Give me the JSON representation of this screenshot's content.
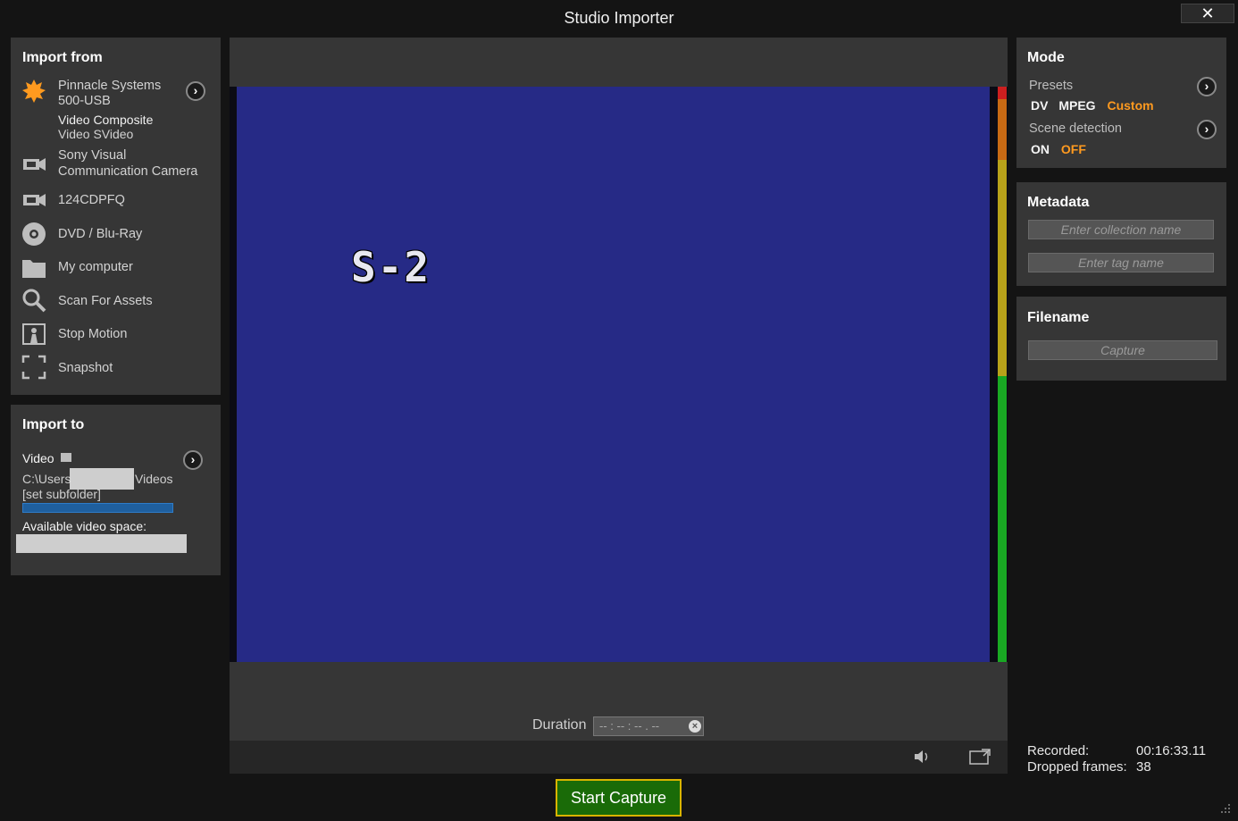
{
  "window": {
    "title": "Studio Importer",
    "close_glyph": "✕"
  },
  "import_from": {
    "title": "Import from",
    "sources": [
      {
        "icon": "gear-orange-icon",
        "line1": "Pinnacle Systems",
        "line2": "500-USB",
        "sub_label": "Video Composite",
        "sub_selected": "Video SVideo",
        "selected": true
      },
      {
        "icon": "camcorder-icon",
        "line1": "Sony Visual",
        "line2": "Communication Camera"
      },
      {
        "icon": "camcorder-icon",
        "line1": "124CDPFQ"
      },
      {
        "icon": "disc-icon",
        "line1": "DVD / Blu-Ray"
      },
      {
        "icon": "folder-icon",
        "line1": "My computer"
      },
      {
        "icon": "search-icon",
        "line1": "Scan For Assets"
      },
      {
        "icon": "stop-motion-icon",
        "line1": "Stop Motion"
      },
      {
        "icon": "snapshot-icon",
        "line1": "Snapshot"
      }
    ]
  },
  "import_to": {
    "title": "Import to",
    "type_label": "Video",
    "path_prefix": "C:\\Users",
    "path_suffix": "Videos",
    "subfolder": "[set subfolder]",
    "space_label": "Available video space:",
    "space_progress": 1.0
  },
  "preview": {
    "video_text": "S-2",
    "duration_label": "Duration",
    "duration_value": "-- : -- : -- . --",
    "level_colors": [
      "#cc1f1f",
      "#c86a14",
      "#b8a21a",
      "#19a823"
    ]
  },
  "mode": {
    "title": "Mode",
    "presets_label": "Presets",
    "presets_options": [
      "DV",
      "MPEG",
      "Custom"
    ],
    "presets_selected": "Custom",
    "scene_label": "Scene detection",
    "scene_options": [
      "ON",
      "OFF"
    ],
    "scene_selected": "OFF"
  },
  "metadata": {
    "title": "Metadata",
    "collection_placeholder": "Enter collection name",
    "tag_placeholder": "Enter tag name"
  },
  "filename": {
    "title": "Filename",
    "value": "Capture"
  },
  "capture": {
    "start_label": "Start Capture",
    "recorded_label": "Recorded:",
    "recorded_value": "00:16:33.11",
    "dropped_label": "Dropped frames:",
    "dropped_value": "38"
  },
  "colors": {
    "accent": "#ff9a1f",
    "panel": "#363636",
    "start_button": "#1a6b08"
  }
}
